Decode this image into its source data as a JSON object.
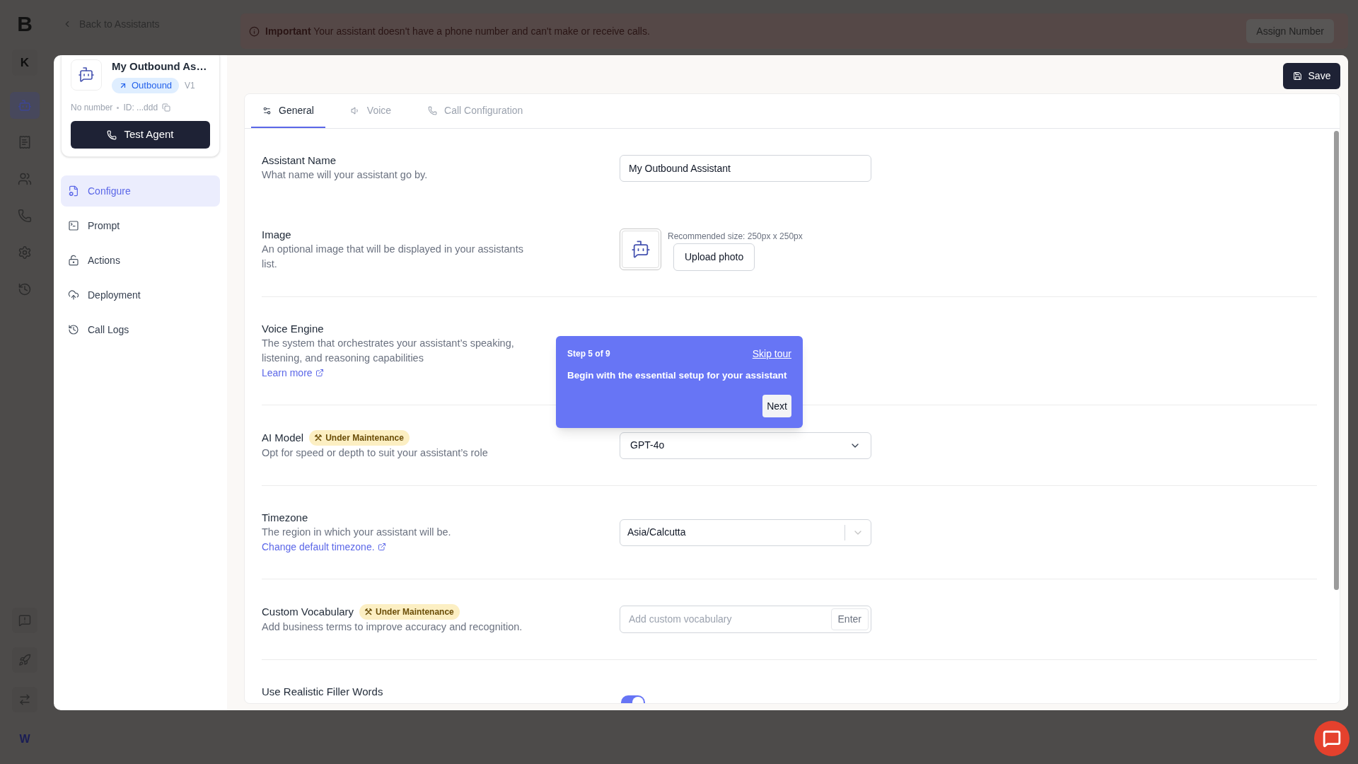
{
  "rail": {
    "logo": "B",
    "workspace": "K",
    "items": [
      {
        "selected": true
      },
      {
        "selected": false
      },
      {
        "selected": false
      },
      {
        "selected": false
      },
      {
        "selected": false
      },
      {
        "selected": false
      }
    ],
    "user": "W"
  },
  "header": {
    "back_link": "Back to Assistants"
  },
  "banner": {
    "message": "**Important** Your assistant doesn't have a phone number and can't make or receive calls.",
    "button": "Assign Number"
  },
  "agent": {
    "name": "My Outbound As…",
    "direction": "Outbound",
    "version": "V1",
    "number": "No number",
    "id": "ID: ...ddd",
    "button": "Test Agent"
  },
  "nav": [
    {
      "label": "Configure",
      "selected": true
    },
    {
      "label": "Prompt",
      "selected": false
    },
    {
      "label": "Actions",
      "selected": false
    },
    {
      "label": "Deployment",
      "selected": false
    },
    {
      "label": "Call Logs",
      "selected": false
    }
  ],
  "save_button": "Save",
  "tabs": [
    {
      "label": "General",
      "selected": true
    },
    {
      "label": "Voice",
      "selected": false
    },
    {
      "label": "Call Configuration",
      "selected": false
    }
  ],
  "sections": [
    {
      "fields": [
        {
          "kind": "text",
          "label": "Assistant Name",
          "description": "What name will your assistant go by.",
          "value": "My Outbound Assistant"
        },
        {
          "kind": "image",
          "label": "Image",
          "description": "An optional image that will be displayed in your assistants list.",
          "hint": "Recommended size: 250px x 250px",
          "button": "Upload photo"
        }
      ]
    },
    {
      "fields": [
        {
          "kind": "info",
          "label": "Voice Engine",
          "description": "The system that orchestrates your assistant’s speaking, listening, and reasoning capabilities",
          "link": "Learn more"
        }
      ]
    },
    {
      "fields": [
        {
          "kind": "select",
          "label": "AI Model",
          "badge": "Under Maintenance",
          "description": "Opt for speed or depth to suit your assistant’s role",
          "value": "GPT-4o"
        }
      ]
    },
    {
      "fields": [
        {
          "kind": "combobox",
          "label": "Timezone",
          "description": "The region in which your assistant will be.",
          "link": "Change default timezone.",
          "value": "Asia/Calcutta"
        }
      ]
    },
    {
      "fields": [
        {
          "kind": "tags",
          "label": "Custom Vocabulary",
          "badge": "Under Maintenance",
          "description": "Add business terms to improve accuracy and recognition.",
          "placeholder": "Add custom vocabulary",
          "button": "Enter"
        }
      ]
    },
    {
      "fields": [
        {
          "kind": "toggle",
          "label": "Use Realistic Filler Words",
          "on": true
        }
      ]
    }
  ],
  "tour": {
    "step": "Step 5 of 9",
    "skip": "Skip tour",
    "message": "Begin with the essential setup for your assistant",
    "next": "Next"
  }
}
